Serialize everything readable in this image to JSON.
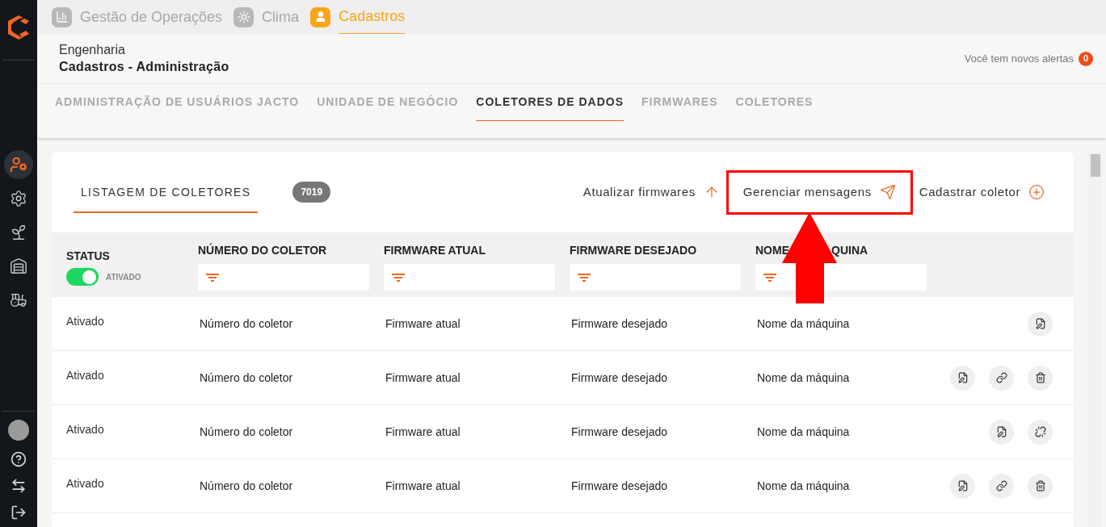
{
  "app_tabs": [
    {
      "label": "Gestão de Operações",
      "kind": "chart",
      "selected": false
    },
    {
      "label": "Clima",
      "kind": "sun",
      "selected": false
    },
    {
      "label": "Cadastros",
      "kind": "user",
      "selected": true
    }
  ],
  "breadcrumb": {
    "section": "Engenharia",
    "page": "Cadastros - Administração"
  },
  "alerts": {
    "label": "Você tem novos alertas",
    "count": "0"
  },
  "section_tabs": [
    {
      "label": "ADMINISTRAÇÃO DE USUÁRIOS JACTO",
      "selected": false
    },
    {
      "label": "UNIDADE DE NEGÓCIO",
      "selected": false
    },
    {
      "label": "COLETORES DE DADOS",
      "selected": true
    },
    {
      "label": "FIRMWARES",
      "selected": false
    },
    {
      "label": "COLETORES",
      "selected": false
    }
  ],
  "sidebar": {
    "items": [
      {
        "kind": "user-settings",
        "selected": true
      },
      {
        "kind": "gear",
        "selected": false
      },
      {
        "kind": "sprout",
        "selected": false
      },
      {
        "kind": "warehouse",
        "selected": false
      },
      {
        "kind": "tractor",
        "selected": false
      }
    ],
    "bottom": [
      {
        "kind": "avatar"
      },
      {
        "kind": "help"
      },
      {
        "kind": "switch"
      },
      {
        "kind": "logout"
      }
    ]
  },
  "list": {
    "title": "LISTAGEM DE COLETORES",
    "count": "7019",
    "actions": [
      {
        "label": "Atualizar firmwares",
        "kind": "upload",
        "highlighted": false
      },
      {
        "label": "Gerenciar mensagens",
        "kind": "send",
        "highlighted": true
      },
      {
        "label": "Cadastrar coletor",
        "kind": "add",
        "highlighted": false
      }
    ]
  },
  "table": {
    "status_column": {
      "label": "STATUS",
      "toggle_label": "ATIVADO",
      "on": true
    },
    "columns": [
      {
        "label": "NÚMERO DO COLETOR"
      },
      {
        "label": "FIRMWARE ATUAL"
      },
      {
        "label": "FIRMWARE DESEJADO"
      },
      {
        "label": "NOME",
        "label_end": "QUINA"
      }
    ],
    "rows": [
      {
        "status": "Ativado",
        "cells": [
          "Número do coletor",
          "Firmware atual",
          "Firmware desejado",
          "Nome da máquina"
        ],
        "actions": [
          {
            "kind": "edit"
          }
        ]
      },
      {
        "status": "Ativado",
        "cells": [
          "Número do coletor",
          "Firmware atual",
          "Firmware desejado",
          "Nome da máquina"
        ],
        "actions": [
          {
            "kind": "edit"
          },
          {
            "kind": "link"
          },
          {
            "kind": "delete"
          }
        ]
      },
      {
        "status": "Ativado",
        "cells": [
          "Número do coletor",
          "Firmware atual",
          "Firmware desejado",
          "Nome da máquina"
        ],
        "actions": [
          {
            "kind": "edit"
          },
          {
            "kind": "unlink"
          }
        ]
      },
      {
        "status": "Ativado",
        "cells": [
          "Número do coletor",
          "Firmware atual",
          "Firmware desejado",
          "Nome da máquina"
        ],
        "actions": [
          {
            "kind": "edit"
          },
          {
            "kind": "link"
          },
          {
            "kind": "delete"
          }
        ]
      }
    ]
  },
  "annotation": {
    "kind": "arrow"
  }
}
